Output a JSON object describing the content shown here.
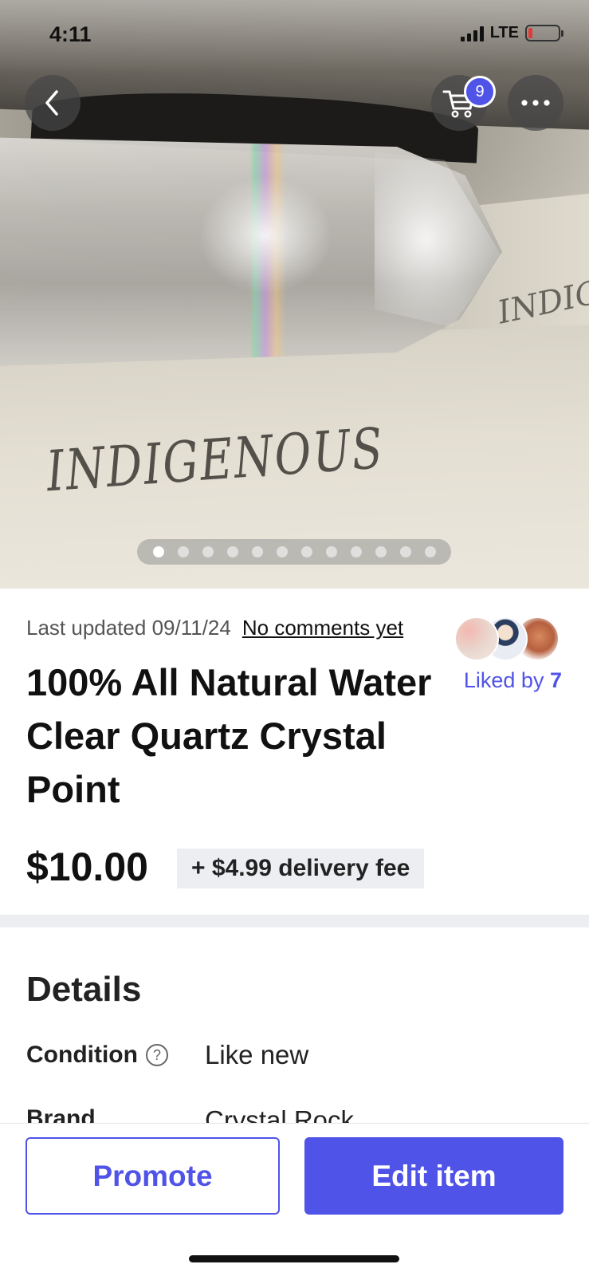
{
  "status_bar": {
    "time": "4:11",
    "network": "LTE",
    "battery_level": 0.15
  },
  "header": {
    "back_icon": "chevron-left-icon",
    "cart_icon": "cart-icon",
    "cart_count": "9",
    "more_icon": "more-horizontal-icon"
  },
  "photo": {
    "stamp_text": "INDIGENOUS",
    "carousel_total": 12,
    "carousel_active_index": 0
  },
  "listing": {
    "last_updated": "Last updated 09/11/24",
    "comments_link": "No comments yet",
    "liked_prefix": "Liked by",
    "liked_count": "7",
    "title": "100% All Natural Water Clear Quartz Crystal Point",
    "price": "$10.00",
    "delivery_fee": "+ $4.99 delivery fee"
  },
  "details": {
    "heading": "Details",
    "rows": [
      {
        "label": "Condition",
        "value": "Like new",
        "help_icon": "question-circle-icon"
      },
      {
        "label": "Brand",
        "value": "Crystal Rock"
      }
    ]
  },
  "actions": {
    "promote_label": "Promote",
    "edit_label": "Edit item"
  },
  "colors": {
    "accent": "#5053e8",
    "chip_bg": "#eceef2",
    "text": "#111111"
  }
}
